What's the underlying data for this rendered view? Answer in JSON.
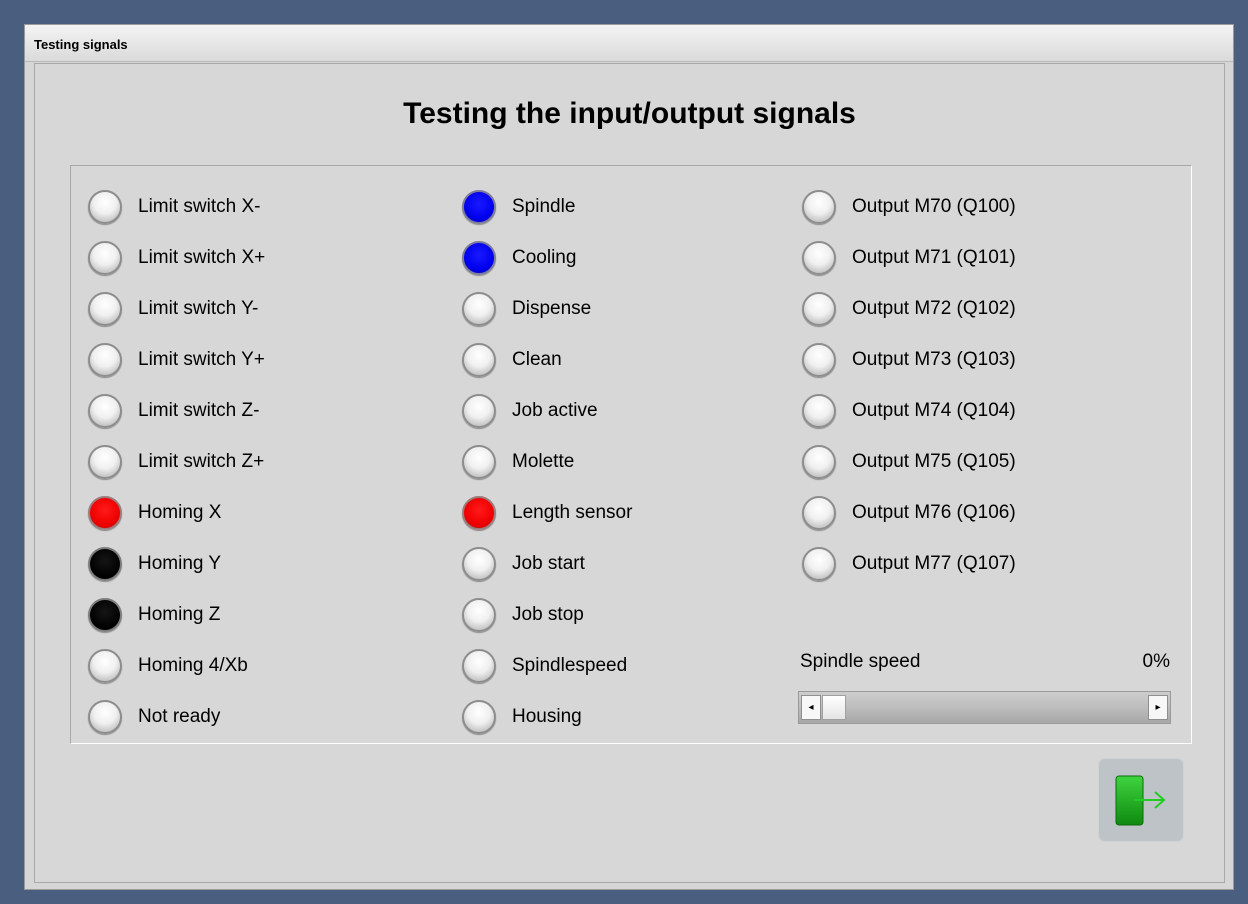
{
  "window": {
    "title": "Testing signals"
  },
  "heading": "Testing the input/output signals",
  "inputs": [
    {
      "label": "Limit switch X-",
      "state": "off"
    },
    {
      "label": "Limit switch X+",
      "state": "off"
    },
    {
      "label": "Limit switch Y-",
      "state": "off"
    },
    {
      "label": "Limit switch Y+",
      "state": "off"
    },
    {
      "label": "Limit switch Z-",
      "state": "off"
    },
    {
      "label": "Limit switch Z+",
      "state": "off"
    },
    {
      "label": "Homing X",
      "state": "red"
    },
    {
      "label": "Homing Y",
      "state": "black"
    },
    {
      "label": "Homing Z",
      "state": "black"
    },
    {
      "label": "Homing 4/Xb",
      "state": "off"
    },
    {
      "label": "Not ready",
      "state": "off"
    }
  ],
  "functions": [
    {
      "label": "Spindle",
      "state": "blue"
    },
    {
      "label": "Cooling",
      "state": "blue"
    },
    {
      "label": "Dispense",
      "state": "off"
    },
    {
      "label": "Clean",
      "state": "off"
    },
    {
      "label": "Job active",
      "state": "off"
    },
    {
      "label": "Molette",
      "state": "off"
    },
    {
      "label": "Length sensor",
      "state": "red"
    },
    {
      "label": "Job start",
      "state": "off"
    },
    {
      "label": "Job stop",
      "state": "off"
    },
    {
      "label": "Spindlespeed",
      "state": "off"
    },
    {
      "label": "Housing",
      "state": "off"
    }
  ],
  "outputs": [
    {
      "label": "Output M70 (Q100)",
      "state": "off"
    },
    {
      "label": "Output M71 (Q101)",
      "state": "off"
    },
    {
      "label": "Output M72 (Q102)",
      "state": "off"
    },
    {
      "label": "Output M73 (Q103)",
      "state": "off"
    },
    {
      "label": "Output M74 (Q104)",
      "state": "off"
    },
    {
      "label": "Output M75 (Q105)",
      "state": "off"
    },
    {
      "label": "Output M76 (Q106)",
      "state": "off"
    },
    {
      "label": "Output M77 (Q107)",
      "state": "off"
    }
  ],
  "spindle_speed": {
    "label": "Spindle speed",
    "value_text": "0%",
    "value": 0,
    "left_arrow": "◂",
    "right_arrow": "▸"
  },
  "exit_button": {
    "icon": "exit-door-arrow-icon",
    "colors": {
      "door": "#1aa81a",
      "arrow": "#22cc22"
    }
  },
  "colors": {
    "desktop": "#4a5f80",
    "window": "#d6d6d6",
    "led_blue": "#0000f0",
    "led_red": "#f00000",
    "led_black": "#000000"
  }
}
